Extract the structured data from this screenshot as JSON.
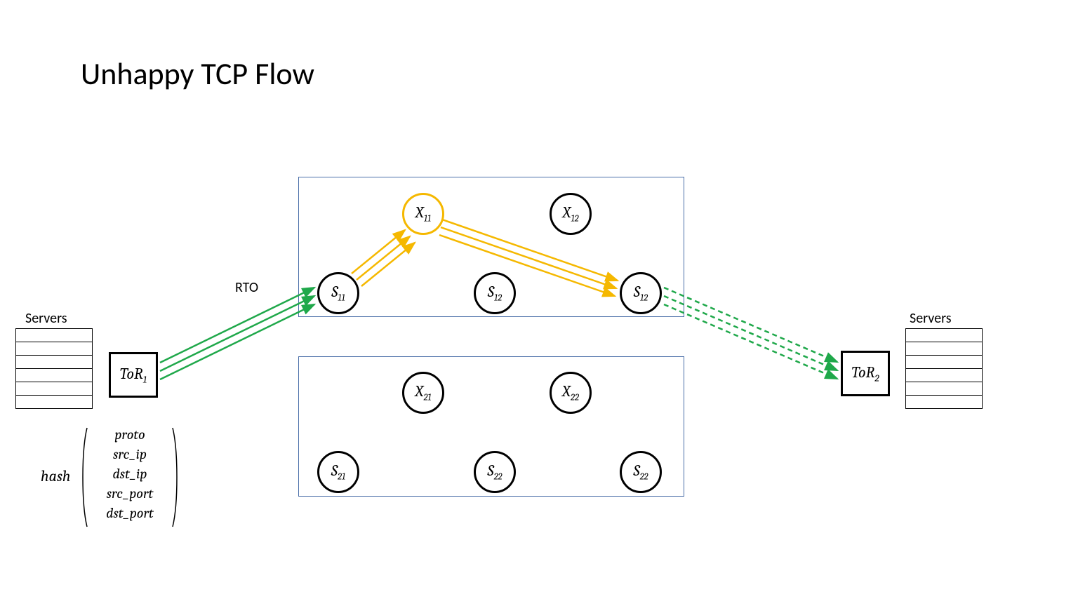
{
  "title": "Unhappy TCP Flow",
  "left": {
    "servers_label": "Servers",
    "tor_label": "ToR",
    "tor_sub": "1"
  },
  "right": {
    "servers_label": "Servers",
    "tor_label": "ToR",
    "tor_sub": "2"
  },
  "rto_label": "RTO",
  "hash": {
    "label": "hash",
    "tuple": [
      "proto",
      "src_ip",
      "dst_ip",
      "src_port",
      "dst_port"
    ]
  },
  "clusters": {
    "top": {
      "X11": {
        "base": "X",
        "sub": "11"
      },
      "X12": {
        "base": "X",
        "sub": "12"
      },
      "S11": {
        "base": "S",
        "sub": "11"
      },
      "S12a": {
        "base": "S",
        "sub": "12"
      },
      "S12b": {
        "base": "S",
        "sub": "12"
      }
    },
    "bottom": {
      "X21": {
        "base": "X",
        "sub": "21"
      },
      "X22": {
        "base": "X",
        "sub": "22"
      },
      "S21": {
        "base": "S",
        "sub": "21"
      },
      "S22a": {
        "base": "S",
        "sub": "22"
      },
      "S22b": {
        "base": "S",
        "sub": "22"
      }
    }
  },
  "colors": {
    "green": "#1fa84a",
    "yellow": "#f5b800",
    "cluster_border": "#4a6ea8"
  }
}
